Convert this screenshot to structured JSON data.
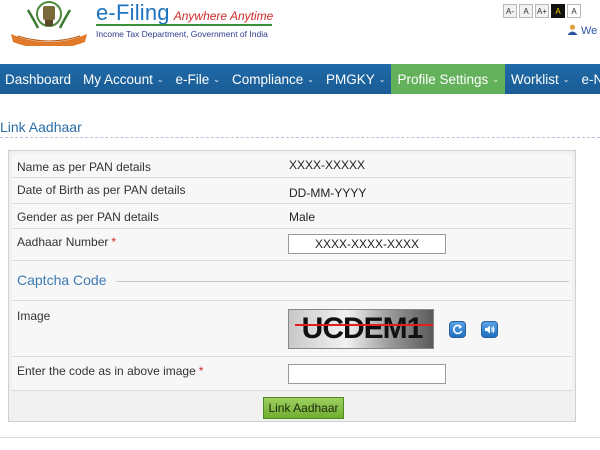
{
  "header": {
    "brand_title": "e-Filing",
    "brand_tagline": "Anywhere Anytime",
    "brand_subtitle": "Income Tax Department, Government of India",
    "welcome_text": "We",
    "font_size_controls": [
      "A-",
      "A",
      "A+",
      "A",
      "A"
    ]
  },
  "nav": {
    "items": [
      {
        "label": "Dashboard",
        "caret": false
      },
      {
        "label": "My Account",
        "caret": true
      },
      {
        "label": "e-File",
        "caret": true
      },
      {
        "label": "Compliance",
        "caret": true
      },
      {
        "label": "PMGKY",
        "caret": true
      },
      {
        "label": "Profile Settings",
        "caret": true,
        "active": true
      },
      {
        "label": "Worklist",
        "caret": true
      },
      {
        "label": "e-N",
        "caret": false
      }
    ],
    "caret_glyph": "⌄"
  },
  "page": {
    "title": "Link Aadhaar"
  },
  "form": {
    "name_label": "Name as per PAN details",
    "name_value": "XXXX-XXXXX",
    "dob_label": "Date of Birth as per PAN details",
    "dob_value": "DD-MM-YYYY",
    "gender_label": "Gender as per PAN details",
    "gender_value": "Male",
    "aadhaar_label": "Aadhaar Number",
    "aadhaar_value": "XXXX-XXXX-XXXX",
    "required_mark": "*",
    "captcha_heading": "Captcha Code",
    "image_label": "Image",
    "captcha_text": "UCDEM1",
    "code_label": "Enter the code as in above image",
    "code_value": "",
    "submit_label": "Link Aadhaar"
  },
  "icons": {
    "refresh": "refresh-icon",
    "audio": "speaker-icon",
    "user": "user-icon",
    "emblem": "emblem-logo"
  },
  "colors": {
    "nav_bg": "#1f6aa8",
    "nav_active": "#63b15a",
    "brand_blue": "#1e73be",
    "required_red": "#d12a2a",
    "button_green": "#8cc34d"
  }
}
